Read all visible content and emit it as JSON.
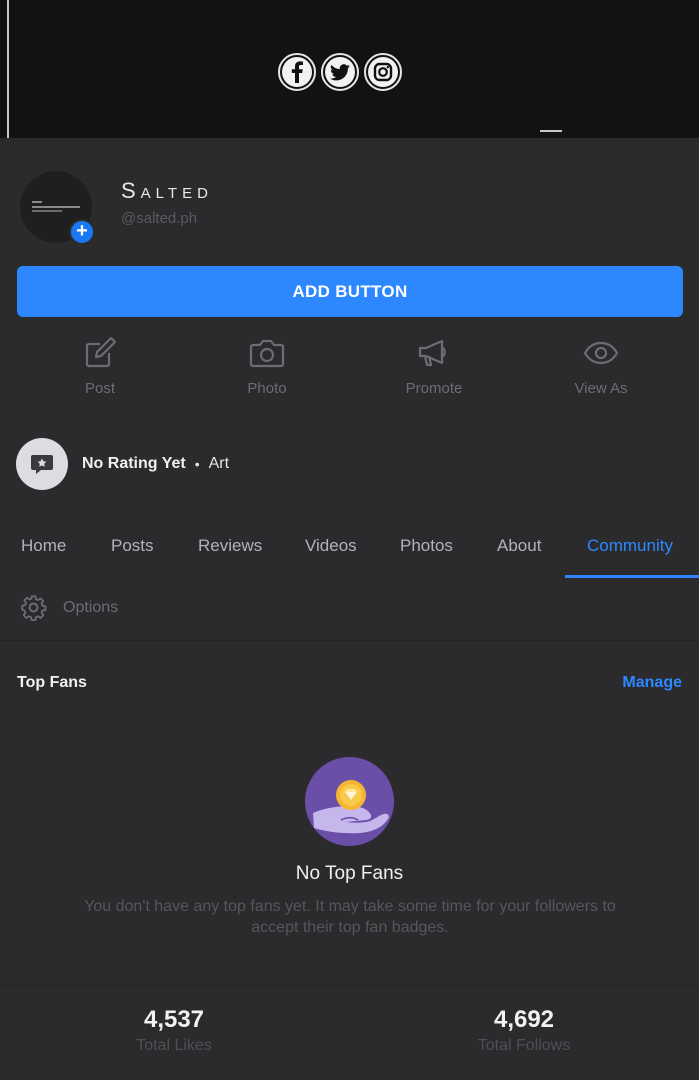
{
  "cover": {
    "social_icons": [
      "facebook-icon",
      "twitter-icon",
      "instagram-icon"
    ]
  },
  "profile": {
    "name": "Salted",
    "handle": "@salted.ph"
  },
  "primary_button": {
    "label": "ADD BUTTON"
  },
  "actions": [
    {
      "label": "Post",
      "icon": "edit-icon"
    },
    {
      "label": "Photo",
      "icon": "camera-icon"
    },
    {
      "label": "Promote",
      "icon": "megaphone-icon"
    },
    {
      "label": "View As",
      "icon": "eye-icon"
    }
  ],
  "rating": {
    "text": "No Rating Yet",
    "separator": "•",
    "category": "Art"
  },
  "tabs": [
    "Home",
    "Posts",
    "Reviews",
    "Videos",
    "Photos",
    "About",
    "Community"
  ],
  "active_tab": "Community",
  "options": {
    "label": "Options"
  },
  "top_fans": {
    "title": "Top Fans",
    "manage_label": "Manage",
    "empty_title": "No Top Fans",
    "empty_desc": "You don't have any top fans yet. It may take some time for your followers to accept their top fan badges."
  },
  "stats": [
    {
      "value": "4,537",
      "label": "Total Likes"
    },
    {
      "value": "4,692",
      "label": "Total Follows"
    }
  ],
  "colors": {
    "accent": "#2d88ff",
    "background": "#2b2b2d",
    "illustration": "#6b4ea8"
  }
}
